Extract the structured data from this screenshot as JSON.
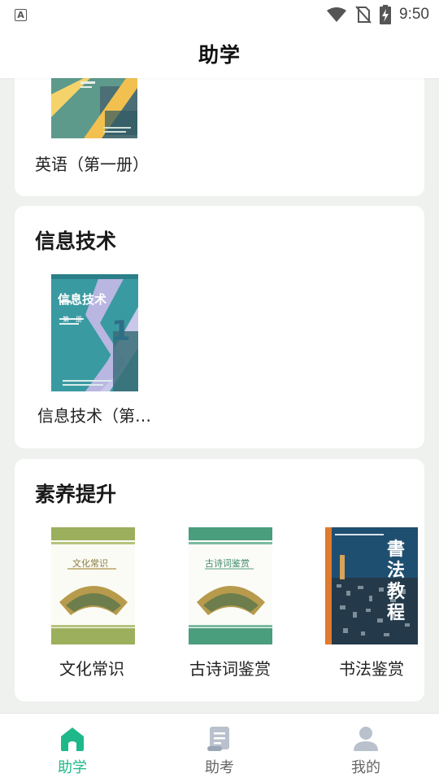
{
  "status_bar": {
    "time": "9:50",
    "app_icon_letter": "A"
  },
  "header": {
    "title": "助学"
  },
  "sections": [
    {
      "title": "",
      "books": [
        {
          "label": "英语（第一册）"
        }
      ]
    },
    {
      "title": "信息技术",
      "books": [
        {
          "label": "信息技术（第…",
          "cover_title": "信息技术",
          "cover_num": "1",
          "cover_sub": "第一册"
        }
      ]
    },
    {
      "title": "素养提升",
      "books": [
        {
          "label": "文化常识",
          "cover_title": "文化常识"
        },
        {
          "label": "古诗词鉴赏",
          "cover_title": "古诗词鉴赏"
        },
        {
          "label": "书法鉴赏",
          "cover_title": "書法教程"
        }
      ]
    }
  ],
  "bottom_nav": [
    {
      "label": "助学",
      "icon": "home-icon",
      "active": true
    },
    {
      "label": "助考",
      "icon": "scroll-icon",
      "active": false
    },
    {
      "label": "我的",
      "icon": "person-icon",
      "active": false
    }
  ],
  "colors": {
    "accent": "#1fb88a",
    "background": "#eef1ee"
  }
}
